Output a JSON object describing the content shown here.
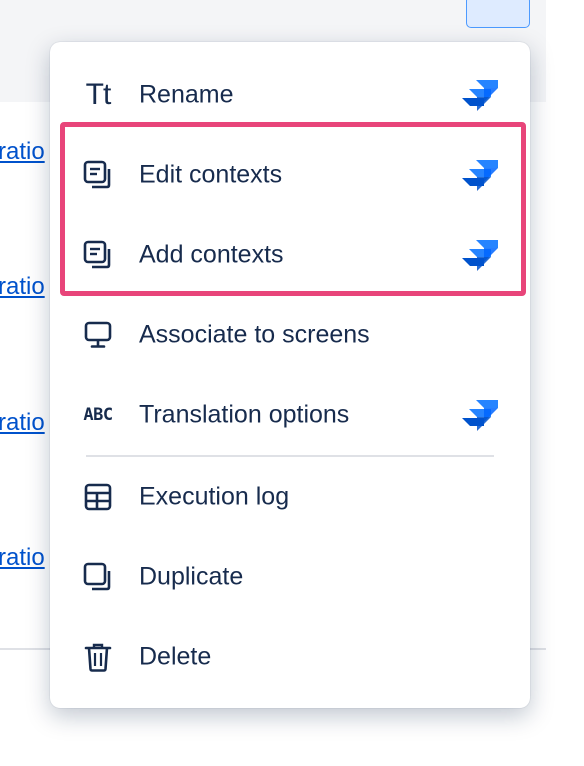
{
  "background": {
    "link_fragments": [
      "ratio",
      "ratio",
      "ratio",
      "ratio"
    ]
  },
  "menu": {
    "items": [
      {
        "label": "Rename",
        "icon": "text-style-icon",
        "glyph": "Tt",
        "badge": true
      },
      {
        "label": "Edit contexts",
        "icon": "contexts-icon",
        "badge": true
      },
      {
        "label": "Add contexts",
        "icon": "contexts-icon",
        "badge": true
      },
      {
        "label": "Associate to screens",
        "icon": "monitor-icon",
        "badge": false
      },
      {
        "label": "Translation options",
        "icon": "abc-icon",
        "glyph": "ABC",
        "badge": true
      },
      {
        "label": "Execution log",
        "icon": "table-icon",
        "badge": false
      },
      {
        "label": "Duplicate",
        "icon": "duplicate-icon",
        "badge": false
      },
      {
        "label": "Delete",
        "icon": "trash-icon",
        "badge": false
      }
    ]
  },
  "colors": {
    "highlight": "#e8457a",
    "link": "#0052cc",
    "badge_dark": "#2684ff",
    "badge_light": "#0052cc"
  }
}
